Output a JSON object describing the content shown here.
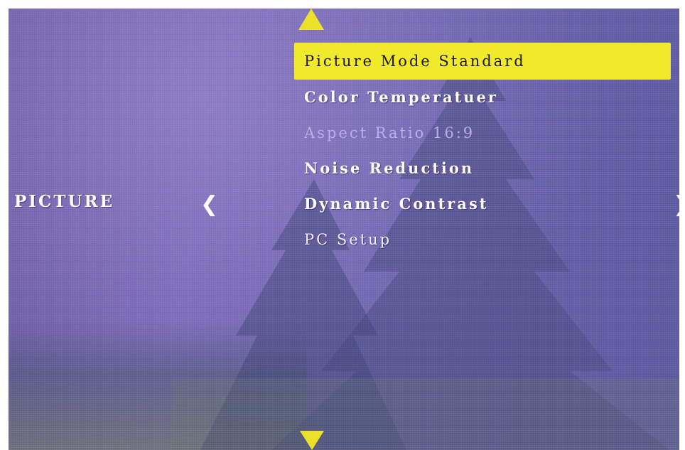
{
  "osd": {
    "category": "PICTURE",
    "nav": {
      "left_arrow_glyph": "❮",
      "right_arrow_glyph": "❯",
      "up_arrow_icon": "triangle-up-icon",
      "down_arrow_icon": "triangle-down-icon"
    },
    "menu_items": [
      {
        "label": "Picture Mode Standard",
        "state": "selected"
      },
      {
        "label": "Color Temperatuer",
        "state": "normal"
      },
      {
        "label": "Aspect Ratio 16:9",
        "state": "disabled"
      },
      {
        "label": "Noise Reduction",
        "state": "normal"
      },
      {
        "label": "Dynamic Contrast",
        "state": "normal"
      },
      {
        "label": "PC Setup",
        "state": "normal"
      }
    ],
    "colors": {
      "highlight": "#f0e92c",
      "arrow": "#ece12a",
      "text": "#ffffff",
      "disabled_text": "#b9aee6",
      "background": "#7a6ab8"
    }
  }
}
